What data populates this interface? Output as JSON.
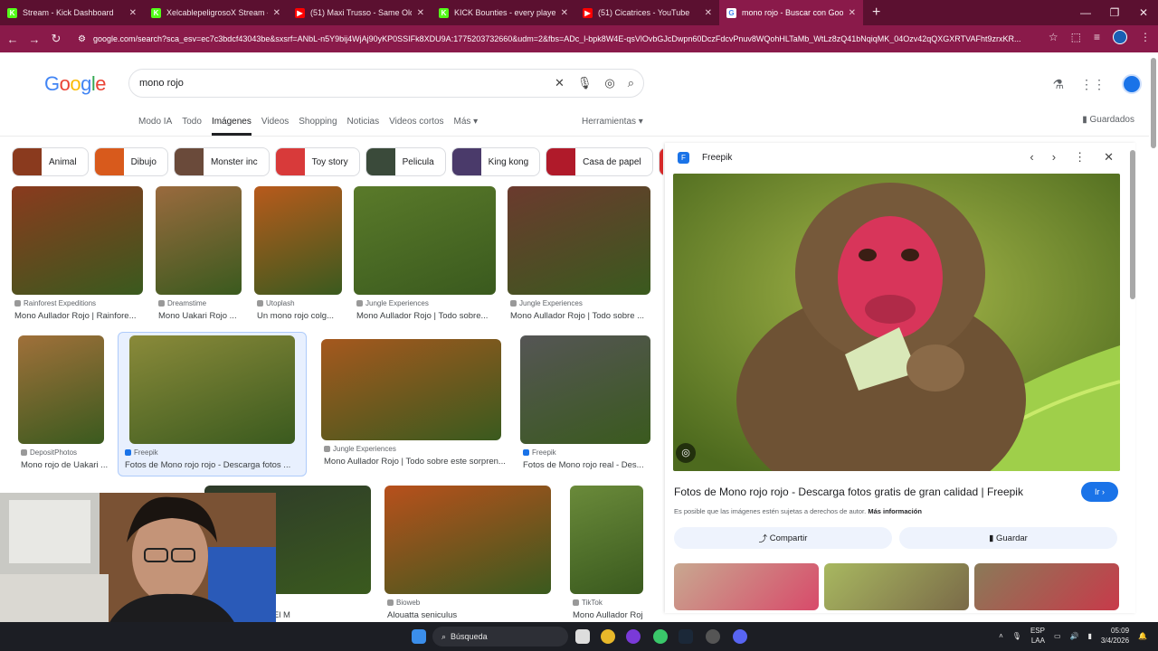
{
  "browser": {
    "tabs": [
      {
        "title": "Stream - Kick Dashboard",
        "fav": "K",
        "color": "#53fc18"
      },
      {
        "title": "XelcablepeligrosoX Stream - W",
        "fav": "K",
        "color": "#53fc18"
      },
      {
        "title": "(51) Maxi Trusso - Same Old St",
        "fav": "▶",
        "color": "#ff0000"
      },
      {
        "title": "KICK Bounties - every player fo",
        "fav": "K",
        "color": "#53fc18"
      },
      {
        "title": "(51) Cicatrices - YouTube",
        "fav": "▶",
        "color": "#ff0000"
      },
      {
        "title": "mono rojo - Buscar con Google",
        "fav": "G",
        "color": "#ffffff",
        "active": true
      }
    ],
    "url": "google.com/search?sca_esv=ec7c3bdcf43043be&sxsrf=ANbL-n5Y9bij4WjAj90yKP0SSIFk8XDU9A:1775203732660&udm=2&fbs=ADc_l-bpk8W4E-qsVlOvbGJcDwpn60DczFdcvPnuv8WQohHLTaMb_WtLz8zQ41bNqiqMK_04Ozv42qQXGXRTVAFht9zrxKR..."
  },
  "google": {
    "logo": "Google",
    "query": "mono rojo",
    "filters": [
      "Modo IA",
      "Todo",
      "Imágenes",
      "Videos",
      "Shopping",
      "Noticias",
      "Videos cortos",
      "Más ▾"
    ],
    "active_filter": "Imágenes",
    "tools": "Herramientas ▾",
    "saved": "Guardados",
    "chips": [
      "Animal",
      "Dibujo",
      "Monster inc",
      "Toy story",
      "Pelicula",
      "King kong",
      "Casa de papel",
      "A"
    ]
  },
  "results": [
    {
      "source": "Rainforest Expeditions",
      "caption": "Mono Aullador Rojo | Rainfore...",
      "color": "#8a3a1e"
    },
    {
      "source": "Dreamstime",
      "caption": "Mono Uakari Rojo ...",
      "color": "#9a6a3e"
    },
    {
      "source": "Utoplash",
      "caption": "Un mono rojo colg...",
      "color": "#b85a1c"
    },
    {
      "source": "Jungle Experiences",
      "caption": "Mono Aullador Rojo | Todo sobre...",
      "color": "#5a7a2a"
    },
    {
      "source": "Jungle Experiences",
      "caption": "Mono Aullador Rojo | Todo sobre ...",
      "color": "#6b3a2e"
    },
    {
      "source": "DepositPhotos",
      "caption": "Mono rojo de Uakari ...",
      "color": "#a0703a"
    },
    {
      "source": "Freepik",
      "caption": "Fotos de Mono rojo rojo - Descarga fotos ...",
      "color": "#8a8a3a"
    },
    {
      "source": "Jungle Experiences",
      "caption": "Mono Aullador Rojo | Todo sobre este sorpren...",
      "color": "#a5581e"
    },
    {
      "source": "Freepik",
      "caption": "Fotos de Mono rojo real - Des...",
      "color": "#555555"
    },
    {
      "source": "",
      "caption": "ágenes gratis de El M",
      "color": "#2e3a2a"
    },
    {
      "source": "Bioweb",
      "caption": "Alouatta seniculus",
      "color": "#b8501c"
    },
    {
      "source": "TikTok",
      "caption": "Mono Aullador Roj",
      "color": "#6a8a3a"
    }
  ],
  "panel": {
    "site": "Freepik",
    "title": "Fotos de Mono rojo rojo - Descarga fotos gratis de gran calidad | Freepik",
    "go": "Ir",
    "note": "Es posible que las imágenes estén sujetas a derechos de autor.",
    "more": "Más información",
    "share": "Compartir",
    "save": "Guardar"
  },
  "taskbar": {
    "search": "Búsqueda",
    "lang": "ESP",
    "lang2": "LAA",
    "time": "05:09",
    "date": "3/4/2026"
  }
}
